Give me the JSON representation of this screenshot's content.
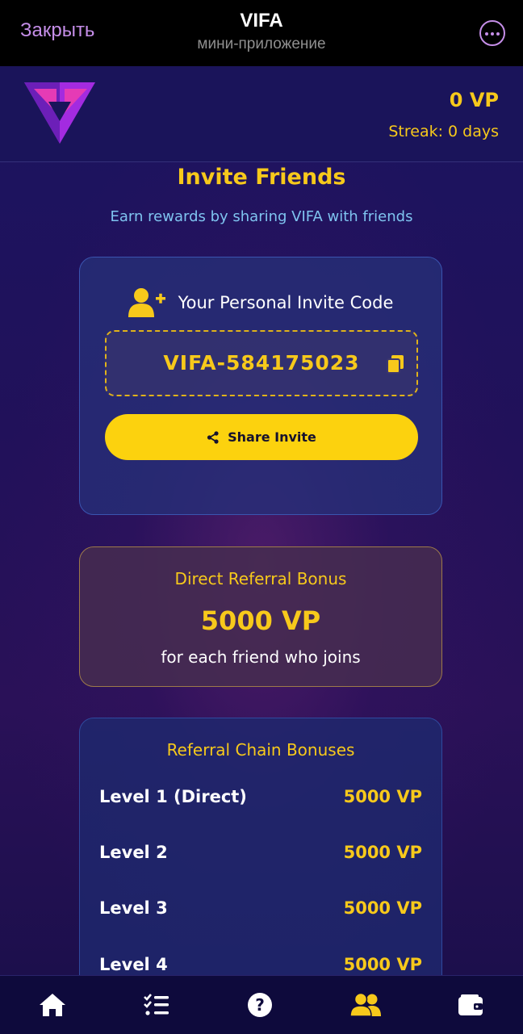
{
  "topbar": {
    "close_label": "Закрыть",
    "title": "VIFA",
    "subtitle": "мини-приложение",
    "more_icon": "more-dots-icon"
  },
  "header": {
    "logo": "vifa-logo",
    "points": "0 VP",
    "streak": "Streak: 0 days"
  },
  "page": {
    "title": "Invite Friends",
    "subtitle": "Earn rewards by sharing VIFA with friends"
  },
  "invite": {
    "icon": "user-plus-icon",
    "heading": "Your Personal Invite Code",
    "code": "VIFA-584175023",
    "copy_icon": "copy-icon",
    "share_icon": "share-icon",
    "share_label": "Share Invite"
  },
  "direct_bonus": {
    "title": "Direct Referral Bonus",
    "amount": "5000 VP",
    "note": "for each friend who joins"
  },
  "chain": {
    "title": "Referral Chain Bonuses",
    "rows": [
      {
        "level": "Level 1 (Direct)",
        "value": "5000 VP"
      },
      {
        "level": "Level 2",
        "value": "5000 VP"
      },
      {
        "level": "Level 3",
        "value": "5000 VP"
      },
      {
        "level": "Level 4",
        "value": "5000 VP"
      }
    ]
  },
  "nav": {
    "items": [
      {
        "icon": "home-icon",
        "active": false
      },
      {
        "icon": "tasks-icon",
        "active": false
      },
      {
        "icon": "help-icon",
        "active": false
      },
      {
        "icon": "friends-icon",
        "active": true
      },
      {
        "icon": "wallet-icon",
        "active": false
      }
    ]
  },
  "colors": {
    "accent": "#f7c91b",
    "background": "#1a1050",
    "telegram_accent": "#c58ee8"
  }
}
